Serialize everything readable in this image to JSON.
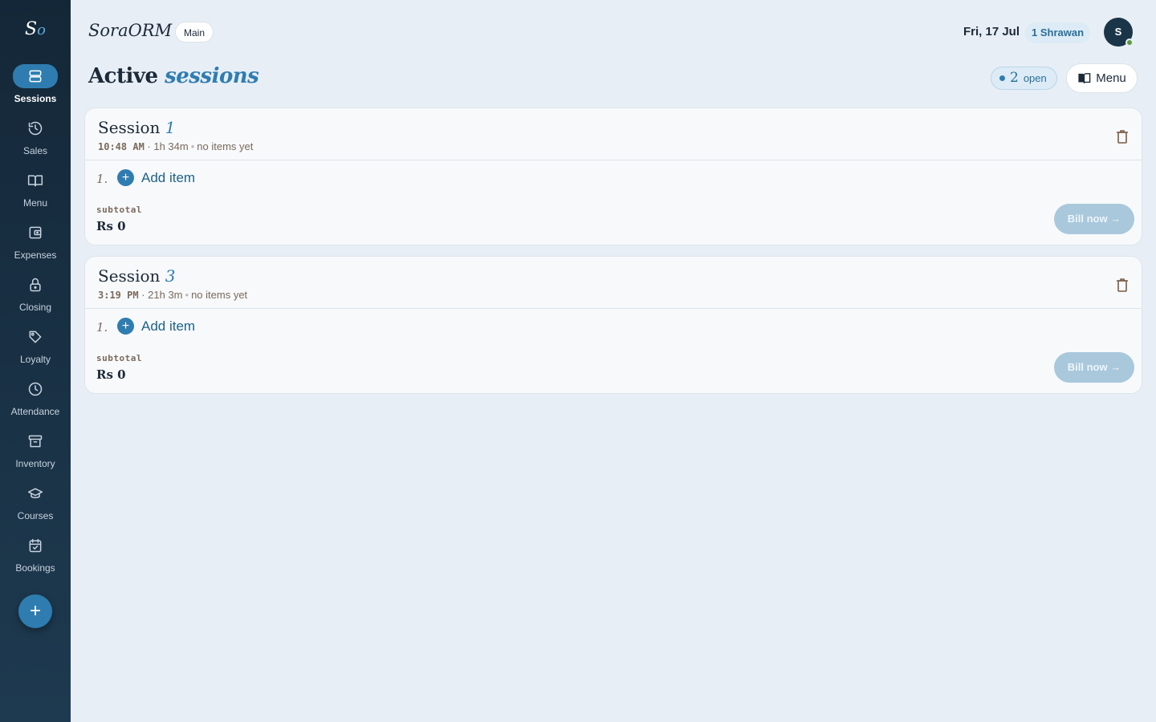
{
  "app": {
    "brand": "SoraORM",
    "logo_s": "S",
    "logo_o": "o",
    "branch": "Main"
  },
  "header": {
    "date": "Fri, 17 Jul",
    "nepali_date": "1 Shrawan",
    "avatar": "S"
  },
  "sidebar": {
    "items": [
      {
        "label": "Sessions",
        "icon": "sessions-icon",
        "active": true
      },
      {
        "label": "Sales",
        "icon": "history-icon"
      },
      {
        "label": "Menu",
        "icon": "book-icon"
      },
      {
        "label": "Expenses",
        "icon": "wallet-icon"
      },
      {
        "label": "Closing",
        "icon": "lock-icon"
      },
      {
        "label": "Loyalty",
        "icon": "tag-icon"
      },
      {
        "label": "Attendance",
        "icon": "clock-icon"
      },
      {
        "label": "Inventory",
        "icon": "archive-icon"
      },
      {
        "label": "Courses",
        "icon": "graduation-cap-icon"
      },
      {
        "label": "Bookings",
        "icon": "calendar-check-icon"
      }
    ],
    "fab_label": "+"
  },
  "page": {
    "title_plain": "Active",
    "title_em": "sessions",
    "open_count": "2",
    "open_label": "open",
    "menu_button": "Menu"
  },
  "sessions": [
    {
      "title": "Session",
      "number": "1",
      "time": "10:48 AM",
      "duration": "· 1h 34m",
      "items_status": "no items yet",
      "line_index": "1.",
      "add_item": "Add item",
      "subtotal_label": "subtotal",
      "subtotal": "Rs 0",
      "bill_button": "Bill now →"
    },
    {
      "title": "Session",
      "number": "3",
      "time": "3:19 PM",
      "duration": "· 21h 3m",
      "items_status": "no items yet",
      "line_index": "1.",
      "add_item": "Add item",
      "subtotal_label": "subtotal",
      "subtotal": "Rs 0",
      "bill_button": "Bill now →"
    }
  ],
  "colors": {
    "accent": "#2f7db0",
    "sidebar": "#142738",
    "background": "#e8eef5",
    "online": "#5b9a3a"
  }
}
